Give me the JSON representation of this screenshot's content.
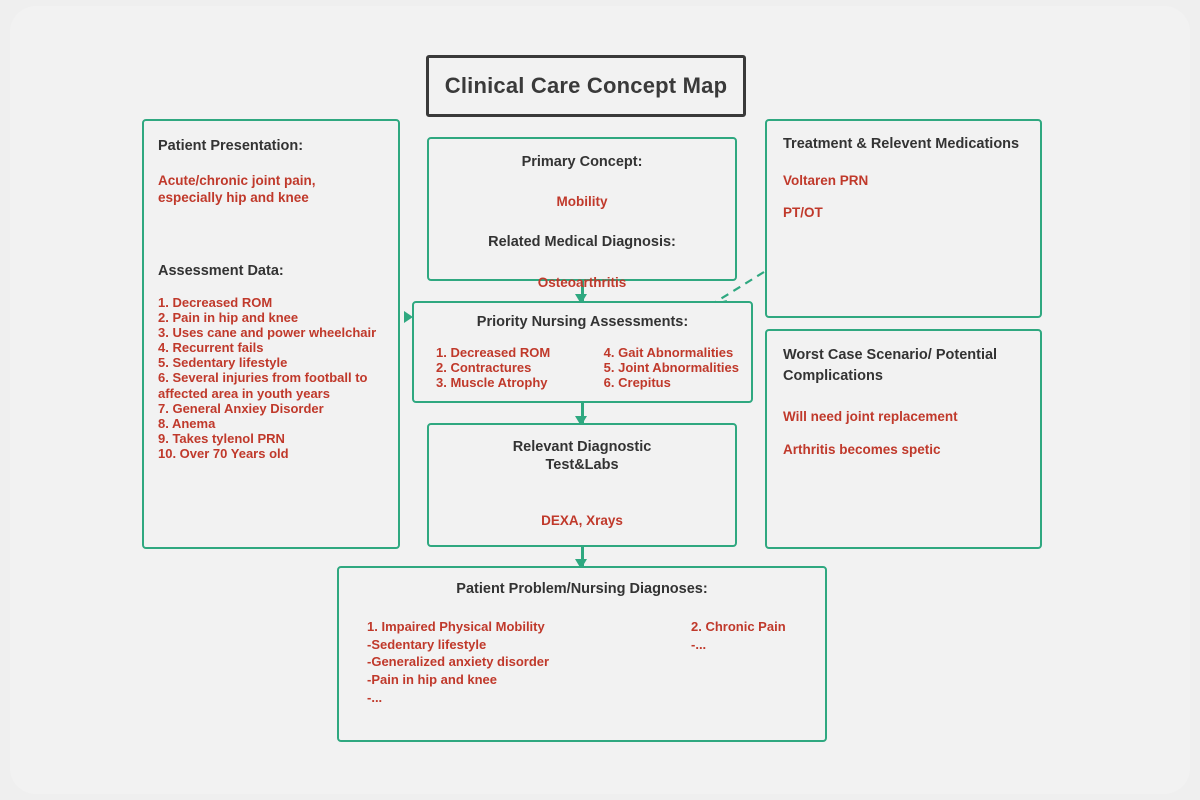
{
  "title": {
    "text": "Clinical Care Concept Map"
  },
  "colors": {
    "box_border": "#2fa880",
    "accent_text": "#c0392b",
    "header_text": "#333333",
    "title_border": "#3a3a3a",
    "background": "#f2f2f2"
  },
  "patient_presentation": {
    "heading": "Patient Presentation:",
    "body": "Acute/chronic joint pain,\nespecially hip and knee",
    "assessment_heading": "Assessment Data:",
    "assessment_items": [
      "1. Decreased ROM",
      "2. Pain in hip and knee",
      "3. Uses cane and power wheelchair",
      "4. Recurrent fails",
      "5. Sedentary lifestyle",
      "6. Several injuries from football to affected area in youth years",
      "7. General Anxiey Disorder",
      "8. Anema",
      "9. Takes tylenol PRN",
      "10. Over 70 Years old"
    ]
  },
  "primary_concept": {
    "heading": "Primary Concept:",
    "value": "Mobility",
    "diagnosis_heading": "Related Medical Diagnosis:",
    "diagnosis_value": "Osteoarthritis"
  },
  "priority_assessments": {
    "heading": "Priority Nursing Assessments:",
    "column_left": [
      "1. Decreased ROM",
      "2. Contractures",
      "3. Muscle Atrophy"
    ],
    "column_right": [
      "4. Gait Abnormalities",
      "5. Joint Abnormalities",
      "6. Crepitus"
    ]
  },
  "diagnostics": {
    "heading": "Relevant Diagnostic\nTest&Labs",
    "value": "DEXA, Xrays"
  },
  "treatment": {
    "heading": "Treatment & Relevent Medications",
    "items": [
      "Voltaren PRN",
      "PT/OT"
    ]
  },
  "worst_case": {
    "heading": "Worst Case Scenario/ Potential\nComplications",
    "items": [
      "Will need joint replacement",
      "Arthritis becomes spetic"
    ]
  },
  "patient_problem": {
    "heading": "Patient Problem/Nursing Diagnoses:",
    "column_left": [
      "1. Impaired Physical Mobility",
      "-Sedentary lifestyle",
      "-Generalized anxiety disorder",
      "-Pain in hip and knee",
      "-..."
    ],
    "column_right": [
      "2. Chronic Pain",
      "-..."
    ]
  }
}
